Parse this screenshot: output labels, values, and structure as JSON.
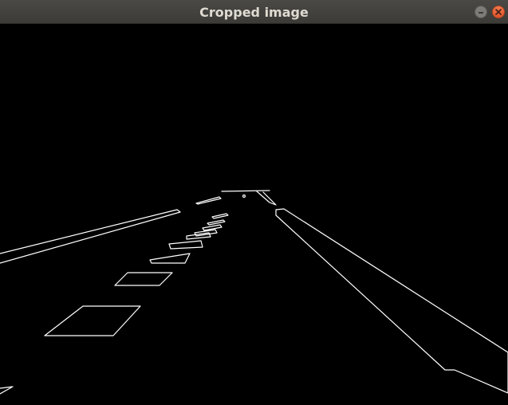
{
  "window": {
    "title": "Cropped image",
    "controls": {
      "minimize_icon": "minimize-icon",
      "close_icon": "close-icon"
    },
    "colors": {
      "titlebar": "#3c3b37",
      "close_button": "#e95420",
      "title_text": "#dfdbd2"
    }
  },
  "image": {
    "description_type": "edge-detection output",
    "background_color": "#000000",
    "line_color": "#ffffff"
  }
}
